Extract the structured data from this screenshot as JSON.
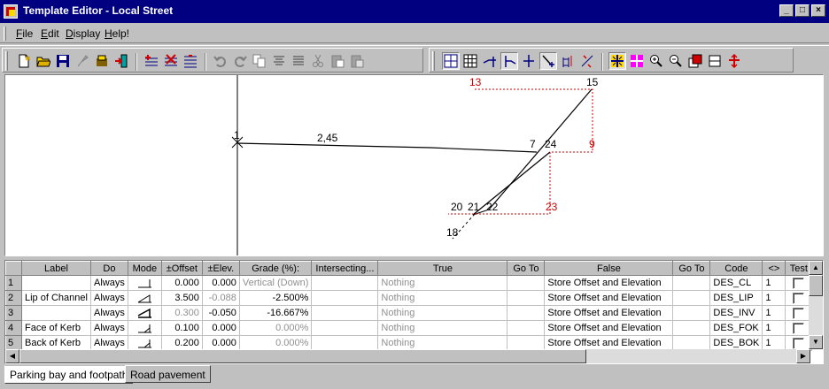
{
  "window": {
    "title": "Template Editor - Local Street"
  },
  "menu": [
    {
      "key": "F",
      "rest": "ile"
    },
    {
      "key": "E",
      "rest": "dit"
    },
    {
      "key": "D",
      "rest": "isplay"
    },
    {
      "key": "H",
      "rest": "elp!"
    }
  ],
  "canvas": {
    "labels": {
      "p1": "1",
      "p245": "2,45",
      "p7": "7",
      "p24": "24",
      "p13": "13",
      "p15": "15",
      "p9": "9",
      "p20": "20",
      "p21": "21",
      "p22": "22",
      "p23": "23",
      "p18": "18"
    }
  },
  "grid": {
    "headers": [
      "",
      "Label",
      "Do",
      "Mode",
      "±Offset",
      "±Elev.",
      "Grade (%):",
      "Intersecting...",
      "True",
      "Go To",
      "False",
      "Go To",
      "Code",
      "<>",
      "Test"
    ],
    "rows": [
      {
        "n": "1",
        "label": "",
        "do": "Always",
        "offset": "0.000",
        "elev": "0.000",
        "grade": "Vertical (Down)",
        "true": "Nothing",
        "false": "Store Offset and Elevation",
        "code": "DES_CL",
        "lt": "1"
      },
      {
        "n": "2",
        "label": "Lip of Channel",
        "do": "Always",
        "offset": "3.500",
        "elev": "-0.088",
        "grade": "-2.500%",
        "true": "Nothing",
        "false": "Store Offset and Elevation",
        "code": "DES_LIP",
        "lt": "1"
      },
      {
        "n": "3",
        "label": "",
        "do": "Always",
        "offset": "0.300",
        "elev": "-0.050",
        "grade": "-16.667%",
        "true": "Nothing",
        "false": "Store Offset and Elevation",
        "code": "DES_INV",
        "lt": "1"
      },
      {
        "n": "4",
        "label": "Face of Kerb",
        "do": "Always",
        "offset": "0.100",
        "elev": "0.000",
        "grade": "0.000%",
        "true": "Nothing",
        "false": "Store Offset and Elevation",
        "code": "DES_FOK",
        "lt": "1"
      },
      {
        "n": "5",
        "label": "Back of Kerb",
        "do": "Always",
        "offset": "0.200",
        "elev": "0.000",
        "grade": "0.000%",
        "true": "Nothing",
        "false": "Store Offset and Elevation",
        "code": "DES_BOK",
        "lt": "1"
      }
    ]
  },
  "tabs": [
    "Parking bay and footpath",
    "Road pavement"
  ],
  "colors": {
    "titlebar": "#000080",
    "construction": "#d00000"
  }
}
